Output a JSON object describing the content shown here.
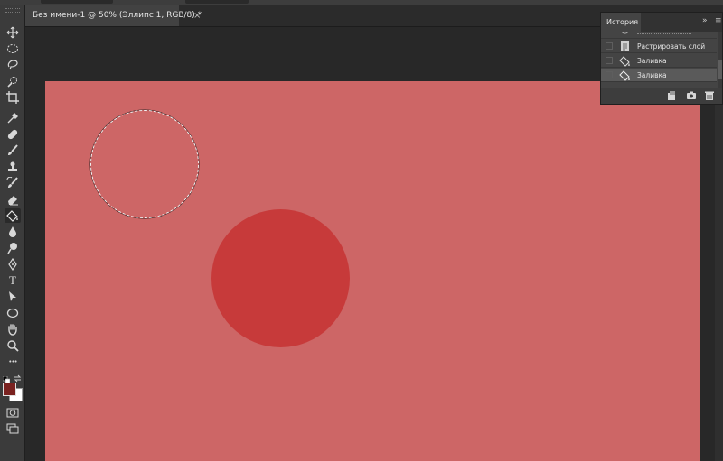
{
  "document_tab": {
    "title": "Без имени-1 @ 50% (Эллипс 1, RGB/8) *",
    "close_glyph": "×"
  },
  "toolbar": {
    "tools": [
      {
        "id": "move",
        "icon": "move-icon"
      },
      {
        "id": "ellipse-marquee",
        "icon": "ellipse-marquee-icon"
      },
      {
        "id": "lasso",
        "icon": "lasso-icon"
      },
      {
        "id": "quick-select",
        "icon": "quick-selection-icon"
      },
      {
        "id": "crop",
        "icon": "crop-icon"
      },
      {
        "id": "eyedropper",
        "icon": "eyedropper-icon"
      },
      {
        "id": "healing",
        "icon": "healing-brush-icon"
      },
      {
        "id": "brush",
        "icon": "brush-icon"
      },
      {
        "id": "stamp",
        "icon": "clone-stamp-icon"
      },
      {
        "id": "history-brush",
        "icon": "history-brush-icon"
      },
      {
        "id": "eraser",
        "icon": "eraser-icon"
      },
      {
        "id": "paint-bucket",
        "icon": "paint-bucket-icon",
        "active": true
      },
      {
        "id": "blur",
        "icon": "blur-icon"
      },
      {
        "id": "dodge",
        "icon": "dodge-icon"
      },
      {
        "id": "pen",
        "icon": "pen-icon"
      },
      {
        "id": "type",
        "icon": "type-icon",
        "glyph": "T"
      },
      {
        "id": "path-select",
        "icon": "path-selection-icon"
      },
      {
        "id": "ellipse-shape",
        "icon": "ellipse-tool-icon"
      },
      {
        "id": "hand",
        "icon": "hand-icon"
      },
      {
        "id": "zoom",
        "icon": "zoom-icon"
      },
      {
        "id": "more",
        "icon": "more-icon",
        "glyph": "•••"
      }
    ],
    "foreground_color": "#7a2220",
    "background_color": "#ffffff"
  },
  "canvas": {
    "background_color": "#cd6666",
    "ellipse_color": "#c73a3a"
  },
  "history_panel": {
    "tab_label": "История",
    "collapse_glyph": "»",
    "menu_glyph": "≡",
    "items": [
      {
        "label": "Растрировать слой",
        "icon": "document-icon",
        "selected": false
      },
      {
        "label": "Заливка",
        "icon": "paint-bucket-icon",
        "selected": false
      },
      {
        "label": "Заливка",
        "icon": "paint-bucket-icon",
        "selected": true
      }
    ],
    "footer_buttons": [
      {
        "icon": "new-document-from-state-icon"
      },
      {
        "icon": "snapshot-camera-icon"
      },
      {
        "icon": "trash-icon"
      }
    ]
  }
}
